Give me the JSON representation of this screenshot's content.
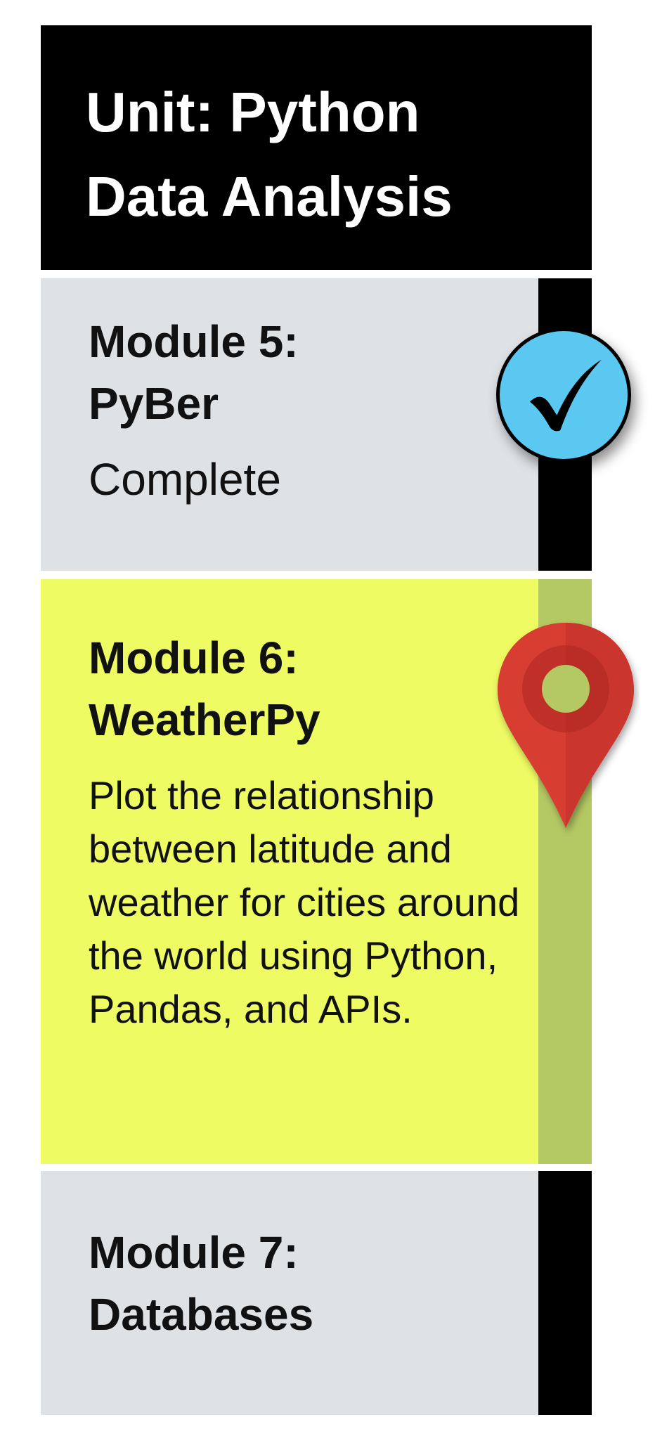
{
  "unit": {
    "title": "Unit: Python Data Analysis"
  },
  "modules": [
    {
      "title_line1": "Module 5:",
      "title_line2": "PyBer",
      "status": "Complete",
      "background": "#dfe2e5",
      "rail_color": "#000000",
      "icon": "check-icon"
    },
    {
      "title_line1": "Module 6:",
      "title_line2": "WeatherPy",
      "description": "Plot the relationship between latitude and weather for cities around the world using Python, Pandas, and APIs.",
      "background": "#eefb62",
      "rail_color": "#b4c863",
      "icon": "map-pin-icon"
    },
    {
      "title_line1": "Module 7:",
      "title_line2": "Databases",
      "background": "#dfe2e5",
      "rail_color": "#000000"
    }
  ],
  "colors": {
    "header_bg": "#000000",
    "check_badge": "#5bc8f1",
    "pin_red": "#d83c30",
    "pin_dark": "#b02a24"
  }
}
